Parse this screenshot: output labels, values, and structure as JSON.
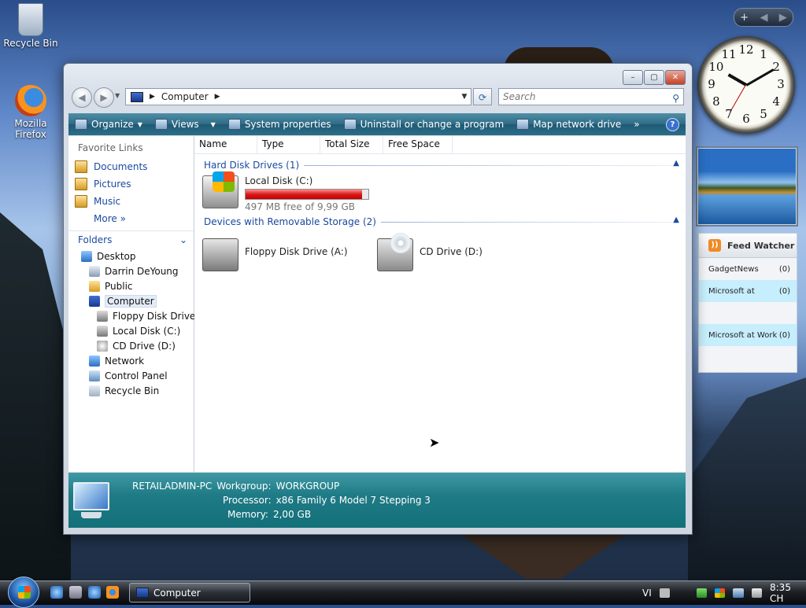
{
  "desktop": {
    "icons": [
      {
        "label": "Recycle Bin"
      },
      {
        "label": "Mozilla Firefox"
      }
    ]
  },
  "gadgets": {
    "clock_numbers": [
      "12",
      "1",
      "2",
      "3",
      "4",
      "5",
      "6",
      "7",
      "8",
      "9",
      "10",
      "11"
    ],
    "feed": {
      "title": "Feed Watcher",
      "items": [
        {
          "name": "GadgetNews",
          "count": "(0)"
        },
        {
          "name": "Microsoft at",
          "count": "(0)"
        },
        {
          "name": "Microsoft at Work",
          "count": "(0)"
        }
      ]
    }
  },
  "window": {
    "controls": {
      "minimize": "–",
      "maximize": "▢",
      "close": "✕"
    },
    "address": {
      "location": "Computer"
    },
    "search": {
      "placeholder": "Search"
    },
    "toolbar": {
      "organize": "Organize",
      "views": "Views",
      "system_properties": "System properties",
      "uninstall": "Uninstall or change a program",
      "map_network": "Map network drive",
      "overflow": "»",
      "help": "?"
    },
    "nav": {
      "favorite_links_title": "Favorite Links",
      "favorites": [
        "Documents",
        "Pictures",
        "Music"
      ],
      "more": "More  »",
      "folders_title": "Folders",
      "tree": [
        {
          "label": "Desktop",
          "level": 0
        },
        {
          "label": "Darrin DeYoung",
          "level": 1
        },
        {
          "label": "Public",
          "level": 1
        },
        {
          "label": "Computer",
          "level": 1
        },
        {
          "label": "Floppy Disk Drive",
          "level": 2
        },
        {
          "label": "Local Disk (C:)",
          "level": 2
        },
        {
          "label": "CD Drive (D:)",
          "level": 2
        },
        {
          "label": "Network",
          "level": 1
        },
        {
          "label": "Control Panel",
          "level": 1
        },
        {
          "label": "Recycle Bin",
          "level": 1
        }
      ]
    },
    "columns": [
      "Name",
      "Type",
      "Total Size",
      "Free Space"
    ],
    "groups": {
      "hard_disk": "Hard Disk Drives (1)",
      "removable": "Devices with Removable Storage (2)"
    },
    "drives": {
      "local_disk": {
        "name": "Local Disk (C:)",
        "free": "497 MB free of 9,99 GB",
        "used_fraction": 0.95
      },
      "floppy": {
        "name": "Floppy Disk Drive (A:)"
      },
      "cd": {
        "name": "CD Drive (D:)"
      }
    },
    "details": {
      "pc_name": "RETAILADMIN-PC",
      "workgroup_label": "Workgroup:",
      "workgroup": "WORKGROUP",
      "processor_label": "Processor:",
      "processor": "x86 Family 6 Model 7 Stepping 3",
      "memory_label": "Memory:",
      "memory": "2,00 GB"
    }
  },
  "taskbar": {
    "task": "Computer",
    "language": "VI",
    "time": "8:35 CH"
  }
}
